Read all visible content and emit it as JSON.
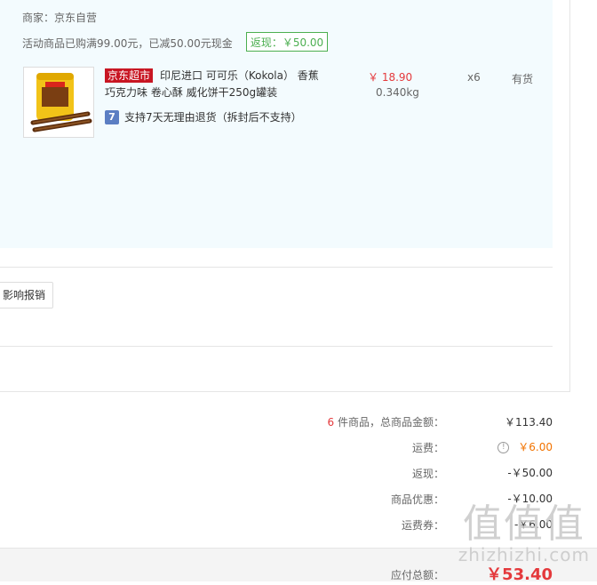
{
  "order": {
    "merchant": "商家：京东自营",
    "promo": "活动商品已购满99.00元，已减50.00元现金",
    "rebate_badge": "返现：￥50.00"
  },
  "item": {
    "tag": "京东超市",
    "title": "印尼进口 可可乐（Kokola） 香蕉巧克力味 卷心酥 威化饼干250g罐装",
    "price": "￥ 18.90",
    "weight": "0.340kg",
    "qty": "x6",
    "stock": "有货",
    "return_icon": "7",
    "return_policy": "支持7天无理由退货（拆封后不支持）"
  },
  "report_button": "影响报销",
  "summary": {
    "count": "6",
    "count_label": " 件商品，总商品金额：",
    "total_goods": "￥113.40",
    "shipping_label": "运费：",
    "shipping_value": "￥6.00",
    "rebate_label": "返现：",
    "rebate_value": "-￥50.00",
    "discount_label": "商品优惠：",
    "discount_value": "-￥10.00",
    "coupon_label": "运费券：",
    "coupon_value": "-￥6.00",
    "payable_label": "应付总额：",
    "payable_value": "￥53.40"
  },
  "watermark": {
    "glyphs": "值值值",
    "url": "zhizhizhi.com"
  },
  "colors": {
    "accent_red": "#e4393c",
    "rebate_green": "#4caf50",
    "panel_bg": "#f3fbfe",
    "shipping_orange": "#f27300"
  }
}
